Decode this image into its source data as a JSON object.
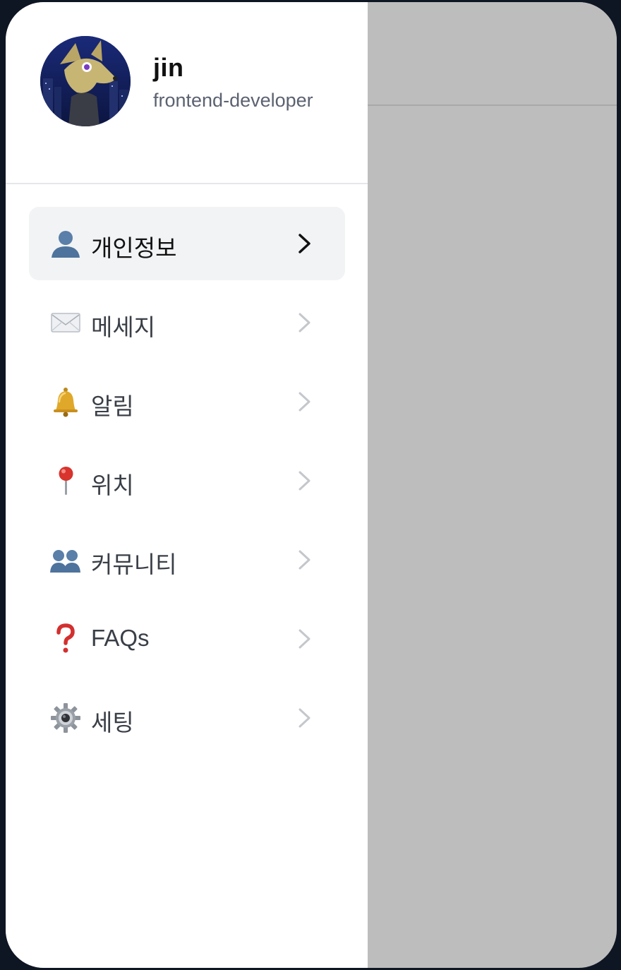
{
  "profile": {
    "name": "jin",
    "role": "frontend-developer"
  },
  "menu": {
    "items": [
      {
        "label": "개인정보",
        "icon": "user-icon",
        "active": true
      },
      {
        "label": "메세지",
        "icon": "envelope-icon",
        "active": false
      },
      {
        "label": "알림",
        "icon": "bell-icon",
        "active": false
      },
      {
        "label": "위치",
        "icon": "pushpin-icon",
        "active": false
      },
      {
        "label": "커뮤니티",
        "icon": "users-icon",
        "active": false
      },
      {
        "label": "FAQs",
        "icon": "question-icon",
        "active": false
      },
      {
        "label": "세팅",
        "icon": "gear-icon",
        "active": false
      }
    ]
  },
  "colors": {
    "overlay": "#bdbdbd",
    "active_item_bg": "#f2f3f5",
    "chevron_active": "#111111",
    "chevron_inactive": "#c4c7cc"
  }
}
